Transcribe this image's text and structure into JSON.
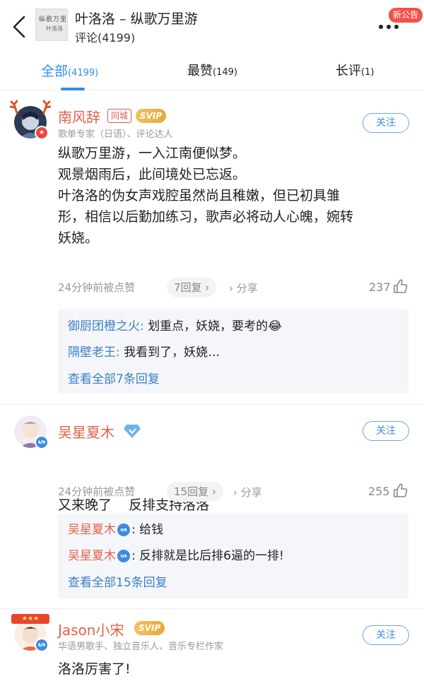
{
  "header": {
    "title": "叶洛洛 – 纵歌万里游",
    "comment_count": "评论(4199)",
    "notice_badge": "新公告",
    "album_text_1": "纵歌万里游",
    "album_text_2": "叶洛洛"
  },
  "tabs": [
    {
      "label": "全部",
      "count": "(4199)",
      "active": true
    },
    {
      "label": "最赞",
      "count": "(149)",
      "active": false
    },
    {
      "label": "长评",
      "count": "(1)",
      "active": false
    }
  ],
  "colors": {
    "accent": "#2b8ff0",
    "reply_user": "#3d7fc6",
    "red_user": "#e4614a",
    "svip": "#e8a83a"
  },
  "comments": [
    {
      "username": "南风辞",
      "tag": "同城",
      "vip": "SVIP",
      "desc": "歌单专家（日语）、评论达人",
      "follow": "关注",
      "text": [
        "纵歌万里游，一入江南便似梦。",
        "观景烟雨后，此间境处已忘返。",
        "叶洛洛的伪女声戏腔虽然尚且稚嫩，但已初具雏",
        "形，相信以后勤加练习，歌声必将动人心魄，婉转",
        "妖娆。"
      ],
      "time": "24分钟前被点赞",
      "replies_pill": "7回复 ›",
      "share": "分享",
      "likes": "237",
      "replies": [
        {
          "user": "御厨团橙之火:",
          "text": " 划重点，妖娆，要考的😂"
        },
        {
          "user": "隔壁老王:",
          "text": " 我看到了，妖娆…"
        }
      ],
      "view_all": "查看全部7条回复"
    },
    {
      "username": "吴星夏木",
      "desc": "",
      "follow": "关注",
      "text": [
        "又来晚了    反排支持洛洛"
      ],
      "time": "24分钟前被点赞",
      "replies_pill": "15回复 ›",
      "share": "分享",
      "likes": "255",
      "replies": [
        {
          "user": "吴星夏木",
          "badge": "ᔕ",
          "text": ": 给钱"
        },
        {
          "user": "吴星夏木",
          "badge": "ᔕ",
          "text": ": 反排就是比后排6逼的一排!"
        }
      ],
      "view_all": "查看全部15条回复"
    },
    {
      "username": "Jason小宋",
      "vip": "SVIP",
      "desc": "华语男歌手、独立音乐人、音乐专栏作家",
      "follow": "关注",
      "text": [
        "洛洛厉害了!"
      ]
    }
  ]
}
